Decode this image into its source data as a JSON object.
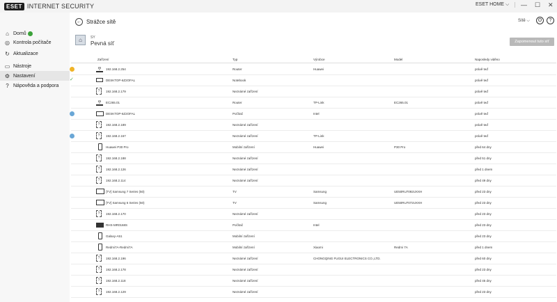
{
  "app": {
    "logo": "ESET",
    "product": "INTERNET SECURITY",
    "home_label": "ESET HOME",
    "window_controls": {
      "minimize": "—",
      "maximize": "☐",
      "close": "✕"
    }
  },
  "sidebar": {
    "items": [
      {
        "label": "Domů",
        "icon": "home-icon",
        "badge": true
      },
      {
        "label": "Kontrola počítače",
        "icon": "scan-icon"
      },
      {
        "label": "Aktualizace",
        "icon": "refresh-icon"
      },
      {
        "label": "Nástroje",
        "icon": "briefcase-icon"
      },
      {
        "label": "Nastavení",
        "icon": "gear-icon",
        "active": true
      },
      {
        "label": "Nápověda a podpora",
        "icon": "help-icon"
      }
    ]
  },
  "page": {
    "title": "Strážce sítě",
    "filter_label": "Sítě",
    "network_small": "SY",
    "network_name": "Pevná síť",
    "forget_button": "Zapomenout tuto síť"
  },
  "table": {
    "headers": [
      "Zařízení",
      "Typ",
      "Výrobce",
      "Model",
      "Naposledy viděno"
    ],
    "rows": [
      {
        "status": "warn",
        "icon": "router",
        "name": "192.168.2.254",
        "type": "Router",
        "vendor": "Huawei",
        "model": "",
        "seen": "právě teď"
      },
      {
        "status": "ok",
        "icon": "laptop",
        "name": "DESKTOP-6Z2OFAL",
        "type": "Notebook",
        "vendor": "",
        "model": "",
        "seen": "právě teď"
      },
      {
        "status": "",
        "icon": "unknown",
        "name": "192.168.2.179",
        "type": "Neznámé zařízení",
        "vendor": "",
        "model": "",
        "seen": "právě teď"
      },
      {
        "status": "",
        "icon": "router",
        "name": "EC265.01",
        "type": "Router",
        "vendor": "TP-Link",
        "model": "EC265.01",
        "seen": "právě teď"
      },
      {
        "status": "info",
        "icon": "monitor",
        "name": "DESKTOP-6Z2OFAL",
        "type": "Počítač",
        "vendor": "Intel",
        "model": "",
        "seen": "právě teď"
      },
      {
        "status": "",
        "icon": "unknown",
        "name": "192.168.2.189",
        "type": "Neznámé zařízení",
        "vendor": "",
        "model": "",
        "seen": "právě teď"
      },
      {
        "status": "info",
        "icon": "unknown",
        "name": "192.168.2.167",
        "type": "Neznámé zařízení",
        "vendor": "TP-Link",
        "model": "",
        "seen": "právě teď"
      },
      {
        "status": "",
        "icon": "phone",
        "name": "Huawei P30 Pro",
        "type": "Mobilní zařízení",
        "vendor": "Huawei",
        "model": "P30 Pro",
        "seen": "před 64 dny"
      },
      {
        "status": "",
        "icon": "unknown",
        "name": "192.168.2.188",
        "type": "Neznámé zařízení",
        "vendor": "",
        "model": "",
        "seen": "před 51 dny"
      },
      {
        "status": "",
        "icon": "unknown",
        "name": "192.168.2.126",
        "type": "Neznámé zařízení",
        "vendor": "",
        "model": "",
        "seen": "před 1 dnem"
      },
      {
        "status": "",
        "icon": "unknown",
        "name": "192.168.2.114",
        "type": "Neznámé zařízení",
        "vendor": "",
        "model": "",
        "seen": "před 49 dny"
      },
      {
        "status": "",
        "icon": "tv",
        "name": "[TV] Samsung 7 Series (50)",
        "type": "TV",
        "vendor": "Samsung",
        "model": "UE50RU7092UXXH",
        "seen": "před 23 dny"
      },
      {
        "status": "",
        "icon": "tv",
        "name": "[TV] Samsung 6 Series (50)",
        "type": "TV",
        "vendor": "Samsung",
        "model": "UE50RU7072UXXH",
        "seen": "před 23 dny"
      },
      {
        "status": "",
        "icon": "unknown",
        "name": "192.168.2.170",
        "type": "Neznámé zařízení",
        "vendor": "",
        "model": "",
        "seen": "před 23 dny"
      },
      {
        "status": "",
        "icon": "pc",
        "name": "RHS-MR0168S",
        "type": "Počítač",
        "vendor": "Intel",
        "model": "",
        "seen": "před 23 dny"
      },
      {
        "status": "",
        "icon": "phone",
        "name": "Galaxy-A51",
        "type": "Mobilní zařízení",
        "vendor": "",
        "model": "",
        "seen": "před 23 dny"
      },
      {
        "status": "",
        "icon": "phone",
        "name": "Redmi7A-Redmi7A",
        "type": "Mobilní zařízení",
        "vendor": "Xiaomi",
        "model": "Redmi 7A",
        "seen": "před 1 dnem"
      },
      {
        "status": "",
        "icon": "unknown",
        "name": "192.168.2.196",
        "type": "Neznámé zařízení",
        "vendor": "CHONGQING FUGUI ELECTRONICS CO.,LTD.",
        "model": "",
        "seen": "před 60 dny"
      },
      {
        "status": "",
        "icon": "unknown",
        "name": "192.168.2.178",
        "type": "Neznámé zařízení",
        "vendor": "",
        "model": "",
        "seen": "před 23 dny"
      },
      {
        "status": "",
        "icon": "unknown",
        "name": "192.168.2.118",
        "type": "Neznámé zařízení",
        "vendor": "",
        "model": "",
        "seen": "před 45 dny"
      },
      {
        "status": "",
        "icon": "unknown",
        "name": "192.168.2.129",
        "type": "Neznámé zařízení",
        "vendor": "",
        "model": "",
        "seen": "před 23 dny"
      }
    ]
  }
}
